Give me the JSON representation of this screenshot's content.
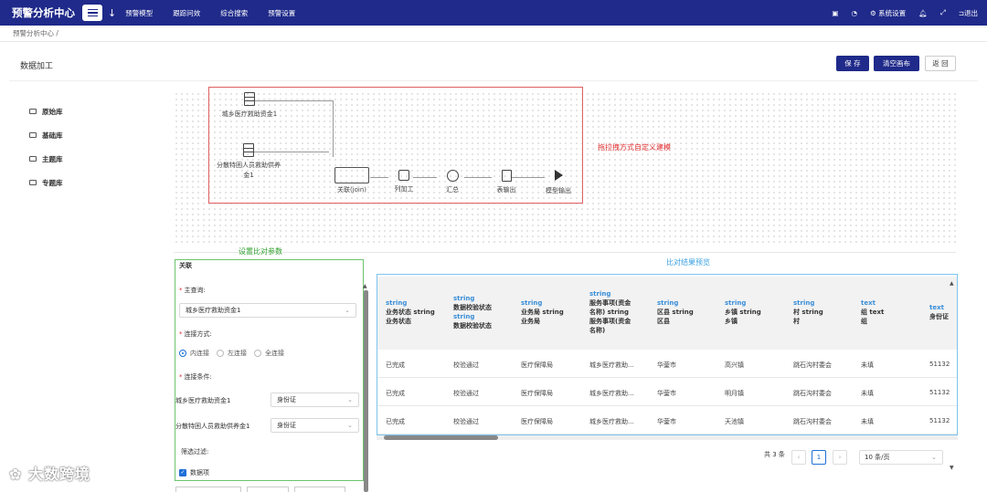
{
  "header": {
    "brand": "预警分析中心",
    "nav": [
      "预警模型",
      "跟踪问效",
      "综合搜索",
      "预警设置"
    ],
    "right": {
      "settings": "系统设置",
      "logout": "退出"
    }
  },
  "breadcrumb": "预警分析中心  /",
  "page": {
    "title": "数据加工",
    "buttons": {
      "save": "保 存",
      "clear": "清空画布",
      "back": "返 回"
    }
  },
  "tree": [
    "原始库",
    "基础库",
    "主题库",
    "专题库"
  ],
  "canvas": {
    "hint": "拖拉拽方式自定义建模",
    "sources": [
      "城乡医疗救助资金1",
      "分散特困人员救助供养金1"
    ],
    "steps": [
      "关联(join)",
      "列加工",
      "汇总",
      "表输出",
      "模型输出"
    ]
  },
  "params": {
    "section_title": "设置比对参数",
    "header": "关联",
    "main_query_label": "主查询:",
    "main_query_value": "城乡医疗救助资金1",
    "join_type_label": "连接方式:",
    "join_types": [
      "内连接",
      "左连接",
      "全连接"
    ],
    "join_cond_label": "连接条件:",
    "conditions": [
      {
        "table": "城乡医疗救助资金1",
        "field": "身份证"
      },
      {
        "table": "分散特困人员救助供养金1",
        "field": "身份证"
      }
    ],
    "filter_label": "筛选过滤:",
    "filter_check": "数据项"
  },
  "result": {
    "title": "比对结果预览",
    "columns": [
      {
        "lines": [
          "string",
          "业务状态 string",
          "业务状态"
        ]
      },
      {
        "lines": [
          "string",
          "数据校验状态",
          "string",
          "数据校验状态"
        ]
      },
      {
        "lines": [
          "string",
          "业务局 string",
          "业务局"
        ]
      },
      {
        "lines": [
          "string",
          "服务事项(资金",
          "名称) string",
          "服务事项(资金",
          "名称)"
        ]
      },
      {
        "lines": [
          "string",
          "区县 string",
          "区县"
        ]
      },
      {
        "lines": [
          "string",
          "乡镇 string",
          "乡镇"
        ]
      },
      {
        "lines": [
          "string",
          "村 string",
          "村"
        ]
      },
      {
        "lines": [
          "text",
          "组 text",
          "组"
        ]
      },
      {
        "lines": [
          "text",
          "身份证"
        ]
      }
    ],
    "rows": [
      [
        "已完成",
        "校验通过",
        "医疗保障局",
        "城乡医疗救助...",
        "华蓥市",
        "高兴镇",
        "跳石沟村委会",
        "未填",
        "51132"
      ],
      [
        "已完成",
        "校验通过",
        "医疗保障局",
        "城乡医疗救助...",
        "华蓥市",
        "明月镇",
        "跳石沟村委会",
        "未填",
        "51132"
      ],
      [
        "已完成",
        "校验通过",
        "医疗保障局",
        "城乡医疗救助...",
        "华蓥市",
        "天池镇",
        "跳石沟村委会",
        "未填",
        "51132"
      ]
    ],
    "total": "共 3 条",
    "page": "1",
    "page_size": "10 条/页"
  },
  "watermark": "大数跨境",
  "colors": {
    "brand": "#1f2a8a",
    "hint_red": "#e03030",
    "param_green": "#2ea02e",
    "preview_blue": "#3aa0e0"
  }
}
